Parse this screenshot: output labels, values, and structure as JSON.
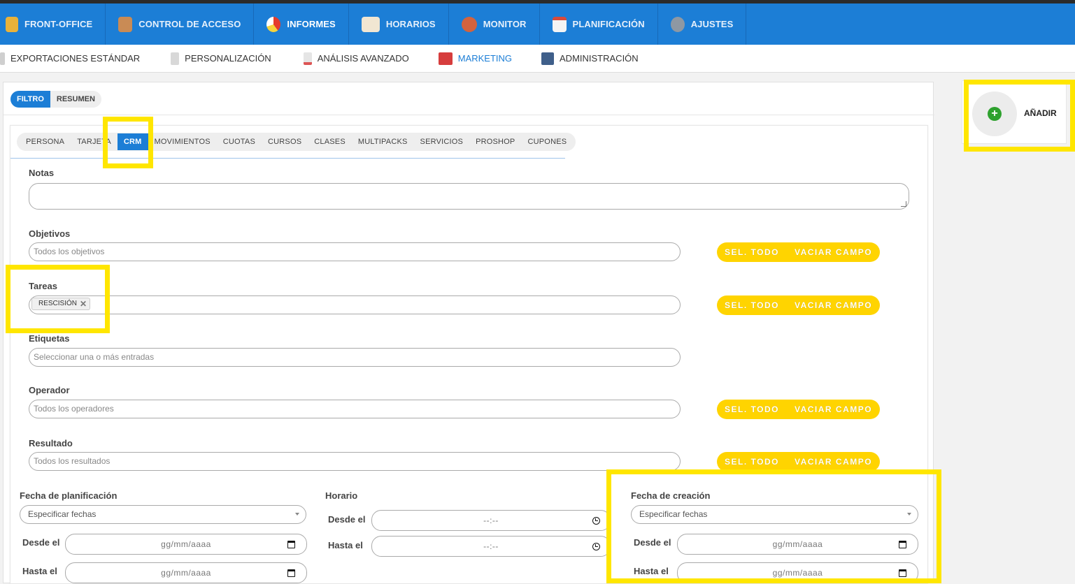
{
  "mainnav": {
    "items": [
      {
        "label": "FRONT-OFFICE",
        "icon": "person-icon"
      },
      {
        "label": "CONTROL DE ACCESO",
        "icon": "access-icon"
      },
      {
        "label": "INFORMES",
        "icon": "pie-chart-icon"
      },
      {
        "label": "HORARIOS",
        "icon": "calendar-grid-icon"
      },
      {
        "label": "MONITOR",
        "icon": "users-icon"
      },
      {
        "label": "PLANIFICACIÓN",
        "icon": "calendar-icon"
      },
      {
        "label": "AJUSTES",
        "icon": "gear-icon"
      }
    ],
    "active": "INFORMES"
  },
  "subnav": {
    "items": [
      {
        "label": "EXPORTACIONES ESTÁNDAR"
      },
      {
        "label": "PERSONALIZACIÓN"
      },
      {
        "label": "ANÁLISIS AVANZADO"
      },
      {
        "label": "MARKETING"
      },
      {
        "label": "ADMINISTRACIÓN"
      }
    ],
    "active": "MARKETING"
  },
  "toptabs": [
    "FILTRO",
    "RESUMEN"
  ],
  "ctabs": [
    "PERSONA",
    "TARJETA",
    "CRM",
    "MOVIMIENTOS",
    "CUOTAS",
    "CURSOS",
    "CLASES",
    "MULTIPACKS",
    "SERVICIOS",
    "PROSHOP",
    "CUPONES"
  ],
  "form": {
    "notas": {
      "label": "Notas"
    },
    "objetivos": {
      "label": "Objetivos",
      "placeholder": "Todos los objetivos"
    },
    "tareas": {
      "label": "Tareas",
      "chip": "RESCISIÓN"
    },
    "etiquetas": {
      "label": "Etiquetas",
      "placeholder": "Seleccionar una o más entradas"
    },
    "operador": {
      "label": "Operador",
      "placeholder": "Todos los operadores"
    },
    "resultado": {
      "label": "Resultado",
      "placeholder": "Todos los resultados"
    },
    "sel_todo": "SEL. TODO",
    "vaciar_campo": "VACIAR CAMPO",
    "fecha_planificacion": {
      "label": "Fecha de planificación",
      "select": "Especificar fechas",
      "desde": "Desde el",
      "hasta": "Hasta el",
      "date_placeholder": "gg/mm/aaaa"
    },
    "horario": {
      "label": "Horario",
      "desde": "Desde el",
      "hasta": "Hasta el",
      "time_placeholder": "--:--"
    },
    "fecha_creacion": {
      "label": "Fecha de creación",
      "select": "Especificar fechas",
      "desde": "Desde el",
      "hasta": "Hasta el",
      "date_placeholder": "gg/mm/aaaa"
    }
  },
  "side": {
    "add_label": "AÑADIR"
  },
  "colors": {
    "primary": "#1c7ed6",
    "accent": "#ffd400",
    "highlight": "#ffe600"
  }
}
